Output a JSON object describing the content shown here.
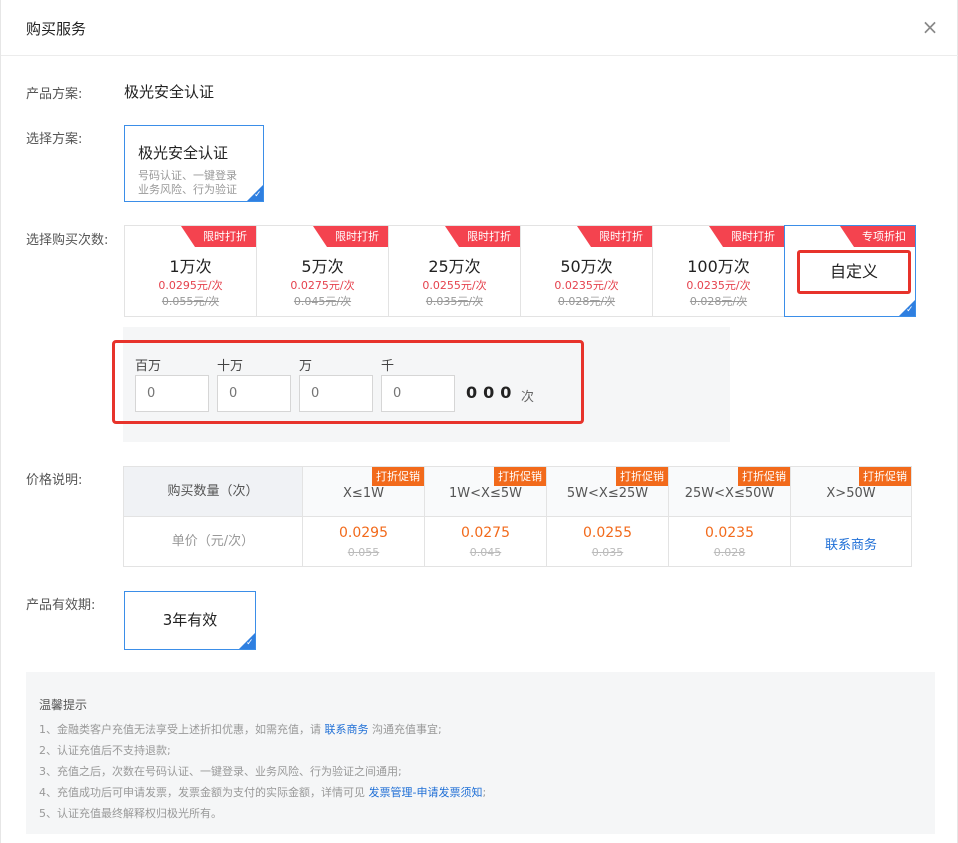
{
  "dialog": {
    "title": "购买服务",
    "close_symbol": "×"
  },
  "product": {
    "label": "产品方案:",
    "value": "极光安全认证"
  },
  "plan": {
    "label": "选择方案:",
    "name": "极光安全认证",
    "desc_line1": "号码认证、一键登录",
    "desc_line2": "业务风险、行为验证"
  },
  "quantity": {
    "label": "选择购买次数:",
    "options": [
      {
        "ribbon": "限时打折",
        "amount": "1万次",
        "price": "0.0295元/次",
        "original": "0.055元/次"
      },
      {
        "ribbon": "限时打折",
        "amount": "5万次",
        "price": "0.0275元/次",
        "original": "0.045元/次"
      },
      {
        "ribbon": "限时打折",
        "amount": "25万次",
        "price": "0.0255元/次",
        "original": "0.035元/次"
      },
      {
        "ribbon": "限时打折",
        "amount": "50万次",
        "price": "0.0235元/次",
        "original": "0.028元/次"
      },
      {
        "ribbon": "限时打折",
        "amount": "100万次",
        "price": "0.0235元/次",
        "original": "0.028元/次"
      }
    ],
    "custom": {
      "ribbon": "专项折扣",
      "label": "自定义"
    }
  },
  "custom_input": {
    "digits": [
      {
        "label": "百万",
        "value": "0"
      },
      {
        "label": "十万",
        "value": "0"
      },
      {
        "label": "万",
        "value": "0"
      },
      {
        "label": "千",
        "value": "0"
      }
    ],
    "fixed_zeros": "000",
    "unit": "次"
  },
  "pricing": {
    "label": "价格说明:",
    "row_header": "购买数量（次）",
    "row_price": "单价（元/次）",
    "columns": [
      {
        "promo": "打折促销",
        "range": "X≤1W",
        "price": "0.0295",
        "original": "0.055"
      },
      {
        "promo": "打折促销",
        "range": "1W<X≤5W",
        "price": "0.0275",
        "original": "0.045"
      },
      {
        "promo": "打折促销",
        "range": "5W<X≤25W",
        "price": "0.0255",
        "original": "0.035"
      },
      {
        "promo": "打折促销",
        "range": "25W<X≤50W",
        "price": "0.0235",
        "original": "0.028"
      },
      {
        "promo": "打折促销",
        "range": "X>50W",
        "contact": "联系商务"
      }
    ]
  },
  "validity": {
    "label": "产品有效期:",
    "value": "3年有效"
  },
  "tips": {
    "title": "温馨提示",
    "l1_pre": "1、金融类客户充值无法享受上述折扣优惠，如需充值，请 ",
    "l1_link": "联系商务",
    "l1_post": " 沟通充值事宜;",
    "l2": "2、认证充值后不支持退款;",
    "l3": "3、充值之后，次数在号码认证、一键登录、业务风险、行为验证之间通用;",
    "l4_pre": "4、充值成功后可申请发票，发票金额为支付的实际金额，详情可见 ",
    "l4_link": "发票管理-申请发票须知",
    "l4_post": ";",
    "l5": "5、认证充值最终解释权归极光所有。"
  }
}
